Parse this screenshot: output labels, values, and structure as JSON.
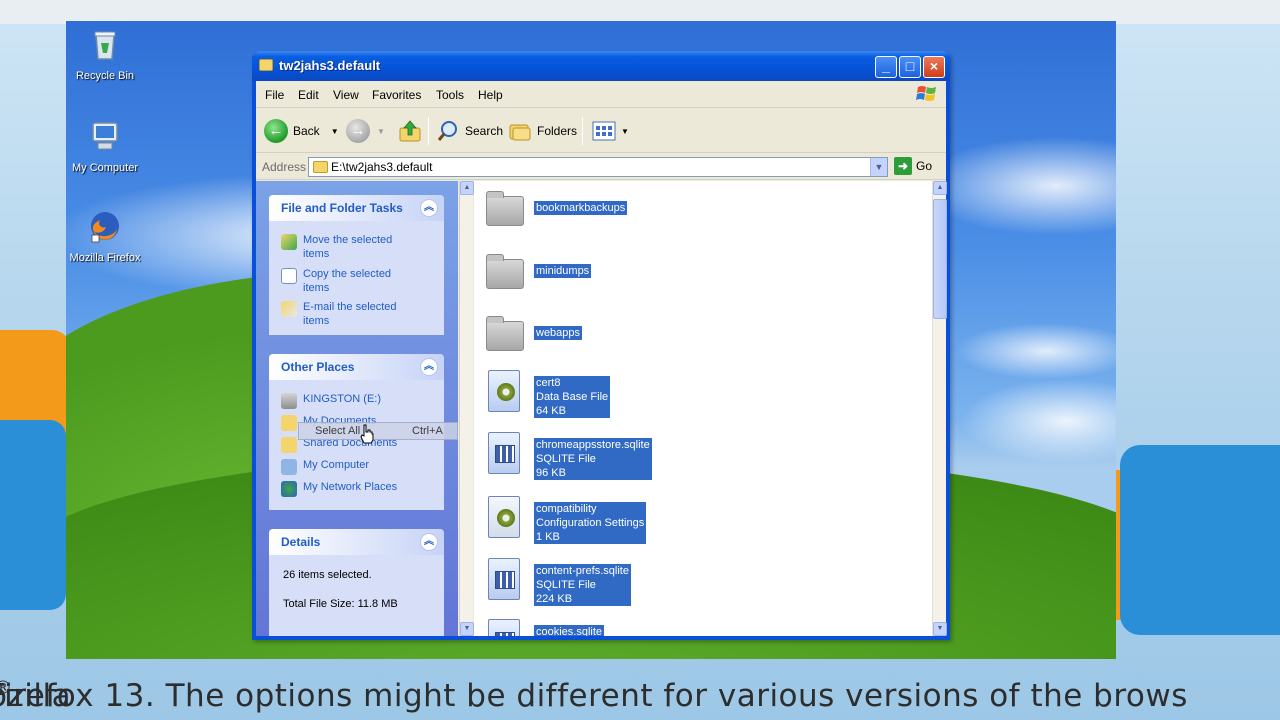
{
  "desktop": {
    "icons": [
      {
        "label": "Recycle Bin"
      },
      {
        "label": "My Computer"
      },
      {
        "label": "Mozilla Firefox"
      }
    ]
  },
  "window": {
    "title": "tw2jahs3.default",
    "menu": [
      "File",
      "Edit",
      "View",
      "Favorites",
      "Tools",
      "Help"
    ],
    "toolbar": {
      "back": "Back",
      "search": "Search",
      "folders": "Folders"
    },
    "address": {
      "label": "Address",
      "value": "E:\\tw2jahs3.default",
      "go": "Go"
    }
  },
  "taskpane": {
    "file_folder_tasks": {
      "heading": "File and Folder Tasks",
      "items": [
        {
          "line1": "Move the selected",
          "line2": "items",
          "icon": "move-icon"
        },
        {
          "line1": "Copy the selected",
          "line2": "items",
          "icon": "copy-icon"
        },
        {
          "line1": "E-mail the selected",
          "line2": "items",
          "icon": "email-icon"
        }
      ]
    },
    "context_overlay": {
      "label": "Select All",
      "shortcut": "Ctrl+A"
    },
    "other_places": {
      "heading": "Other Places",
      "items": [
        {
          "label": "KINGSTON (E:)",
          "icon": "drive-icon"
        },
        {
          "label": "My Documents",
          "icon": "folder-icon"
        },
        {
          "label": "Shared Documents",
          "icon": "folder-icon"
        },
        {
          "label": "My Computer",
          "icon": "computer-icon"
        },
        {
          "label": "My Network Places",
          "icon": "network-icon"
        }
      ]
    },
    "details": {
      "heading": "Details",
      "selected": "26 items selected.",
      "total": "Total File Size: 11.8 MB"
    }
  },
  "files": [
    {
      "name": "bookmarkbackups",
      "type": "folder"
    },
    {
      "name": "minidumps",
      "type": "folder"
    },
    {
      "name": "webapps",
      "type": "folder"
    },
    {
      "name": "cert8",
      "kind": "Data Base File",
      "size": "64 KB",
      "type": "db"
    },
    {
      "name": "chromeappsstore.sqlite",
      "kind": "SQLITE File",
      "size": "96 KB",
      "type": "sqlite"
    },
    {
      "name": "compatibility",
      "kind": "Configuration Settings",
      "size": "1 KB",
      "type": "config"
    },
    {
      "name": "content-prefs.sqlite",
      "kind": "SQLITE File",
      "size": "224 KB",
      "type": "sqlite"
    },
    {
      "name": "cookies.sqlite",
      "type": "sqlite"
    }
  ],
  "caption": {
    "text_before": "ozilla",
    "superscript": "®",
    "text_after": " Firefox 13. The options might be different for various versions of the brows"
  },
  "colors": {
    "selection": "#316ac5",
    "titlebar": "#0553d7",
    "taskpane_link": "#215dc6"
  }
}
